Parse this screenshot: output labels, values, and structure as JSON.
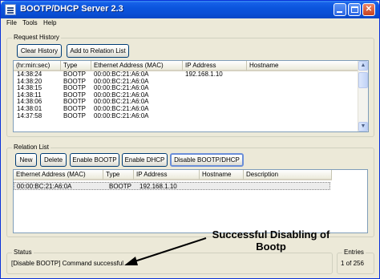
{
  "window": {
    "title": "BOOTP/DHCP Server 2.3",
    "controls": {
      "minimize": "minimize",
      "maximize": "maximize",
      "close": "✕"
    }
  },
  "menu": [
    "File",
    "Tools",
    "Help"
  ],
  "request_history": {
    "group_label": "Request History",
    "buttons": {
      "clear": "Clear History",
      "add_relation": "Add to Relation List"
    },
    "columns": [
      "(hr:min:sec)",
      "Type",
      "Ethernet Address (MAC)",
      "IP Address",
      "Hostname"
    ],
    "rows": [
      {
        "time": "14:38:24",
        "type": "BOOTP",
        "mac": "00:00:BC:21:A6:0A",
        "ip": "192.168.1.10",
        "hostname": ""
      },
      {
        "time": "14:38:20",
        "type": "BOOTP",
        "mac": "00:00:BC:21:A6:0A",
        "ip": "",
        "hostname": ""
      },
      {
        "time": "14:38:15",
        "type": "BOOTP",
        "mac": "00:00:BC:21:A6:0A",
        "ip": "",
        "hostname": ""
      },
      {
        "time": "14:38:11",
        "type": "BOOTP",
        "mac": "00:00:BC:21:A6:0A",
        "ip": "",
        "hostname": ""
      },
      {
        "time": "14:38:06",
        "type": "BOOTP",
        "mac": "00:00:BC:21:A6:0A",
        "ip": "",
        "hostname": ""
      },
      {
        "time": "14:38:01",
        "type": "BOOTP",
        "mac": "00:00:BC:21:A6:0A",
        "ip": "",
        "hostname": ""
      },
      {
        "time": "14:37:58",
        "type": "BOOTP",
        "mac": "00:00:BC:21:A6:0A",
        "ip": "",
        "hostname": ""
      }
    ]
  },
  "relation_list": {
    "group_label": "Relation List",
    "buttons": {
      "new": "New",
      "delete": "Delete",
      "enable_bootp": "Enable BOOTP",
      "enable_dhcp": "Enable DHCP",
      "disable_bootp": "Disable BOOTP/DHCP"
    },
    "columns": [
      "Ethernet Address (MAC)",
      "Type",
      "IP Address",
      "Hostname",
      "Description"
    ],
    "rows": [
      {
        "mac": "00:00:BC:21:A6:0A",
        "type": "BOOTP",
        "ip": "192.168.1.10",
        "hostname": "",
        "description": ""
      }
    ]
  },
  "status": {
    "group_label": "Status",
    "text": "[Disable BOOTP] Command successful"
  },
  "entries": {
    "group_label": "Entries",
    "text": "1 of 256"
  },
  "annotation": {
    "line1": "Successful Disabling of",
    "line2": "Bootp"
  },
  "scrollbar": {
    "up": "▲",
    "down": "▼"
  }
}
